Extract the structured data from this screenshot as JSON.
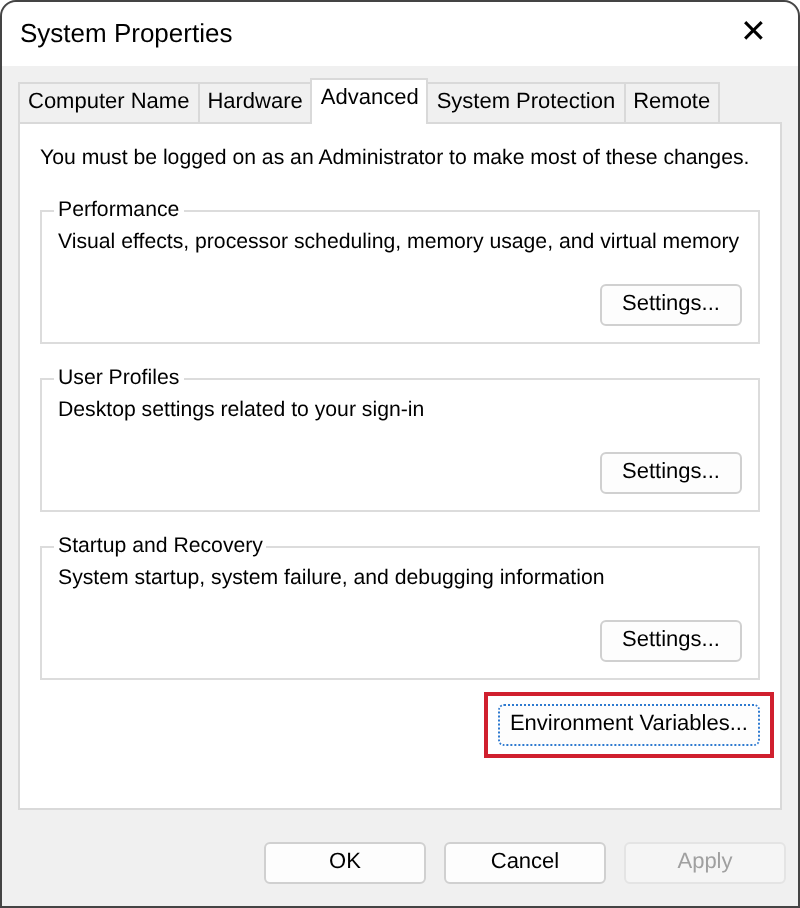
{
  "window": {
    "title": "System Properties",
    "close": "✕"
  },
  "tabs": [
    {
      "label": "Computer Name",
      "selected": false
    },
    {
      "label": "Hardware",
      "selected": false
    },
    {
      "label": "Advanced",
      "selected": true
    },
    {
      "label": "System Protection",
      "selected": false
    },
    {
      "label": "Remote",
      "selected": false
    }
  ],
  "notice": "You must be logged on as an Administrator to make most of these changes.",
  "groups": [
    {
      "title": "Performance",
      "description": "Visual effects, processor scheduling, memory usage, and virtual memory",
      "button": "Settings..."
    },
    {
      "title": "User Profiles",
      "description": "Desktop settings related to your sign-in",
      "button": "Settings..."
    },
    {
      "title": "Startup and Recovery",
      "description": "System startup, system failure, and debugging information",
      "button": "Settings..."
    }
  ],
  "environment_button": {
    "label": "Environment Variables...",
    "highlighted": true
  },
  "buttons": [
    {
      "label": "OK",
      "disabled": false
    },
    {
      "label": "Cancel",
      "disabled": false
    },
    {
      "label": "Apply",
      "disabled": true
    }
  ]
}
